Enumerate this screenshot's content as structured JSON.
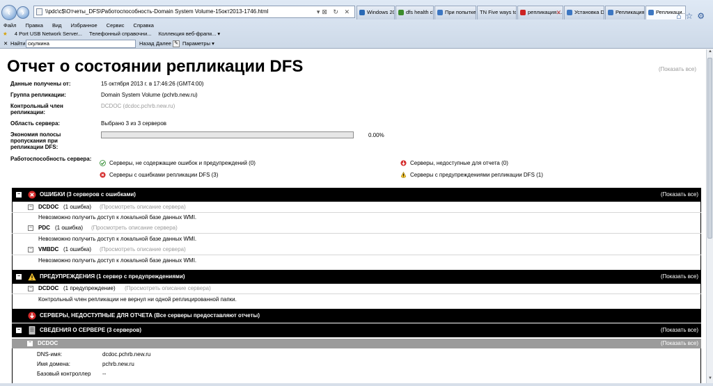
{
  "browser": {
    "address": "\\\\pdc\\c$\\Отчеты_DFS\\Работоспособность-Domain System Volume-15окт2013-1746.html",
    "tabs": [
      {
        "label": "Windows 201...",
        "color": "#2a6ab5"
      },
      {
        "label": "dfs health ch...",
        "color": "#3c8c2c"
      },
      {
        "label": "При попытке...",
        "color": "#3d77c2"
      },
      {
        "label": "TN Five ways to ...",
        "color": "#555555"
      },
      {
        "label": "репликация ...",
        "color": "#cc2222"
      },
      {
        "label": "Установка D...",
        "color": "#3d77c2"
      },
      {
        "label": "Репликация ...",
        "color": "#3d77c2"
      },
      {
        "label": "Репликаци...",
        "color": "#3d77c2"
      }
    ],
    "menu": [
      "Файл",
      "Правка",
      "Вид",
      "Избранное",
      "Сервис",
      "Справка"
    ],
    "favorites": [
      "4 Port USB Network Server...",
      "Телефонный справочни...",
      "Коллекция веб-фрагм... ▾"
    ],
    "find": {
      "close": "✕",
      "label": "Найти:",
      "value": "скулкина",
      "prev": "Назад",
      "next": "Далее",
      "options": "Параметры ▾"
    }
  },
  "report": {
    "title": "Отчет о состоянии репликации DFS",
    "show_all": "(Показать все)",
    "info": {
      "received_label": "Данные получены от:",
      "received_value": "15 октября 2013 г. в 17:46:26 (GMT4:00)",
      "group_label": "Группа репликации:",
      "group_value": "Domain System Volume (pchrb.new.ru)",
      "member_label": "Контрольный член репликации:",
      "member_value": "DCDOC (dcdoc.pchrb.new.ru)",
      "scope_label": "Область сервера:",
      "scope_value": "Выбрано 3 из 3 серверов",
      "bandwidth_label": "Экономия полосы пропускания при репликации DFS:",
      "bandwidth_value": "0.00%",
      "bandwidth_fraction": 0,
      "health_label": "Работоспособность сервера:"
    },
    "legend": {
      "ok": "Серверы, не содержащие ошибок и предупреждений (0)",
      "errors": "Серверы с ошибками репликации DFS (3)",
      "unavailable": "Серверы, недоступные для отчета (0)",
      "warnings": "Серверы с предупреждениями репликации DFS (1)"
    },
    "errors_section": {
      "title": "ОШИБКИ  (3 серверов с ошибками)",
      "show_all": "(Показать все)",
      "servers": [
        {
          "name": "DCDOC",
          "count": "(1 ошибка)",
          "link": "(Просмотреть описание сервера)",
          "message": "Невозможно получить доступ к локальной базе данных WMI."
        },
        {
          "name": "PDC",
          "count": "(1 ошибка)",
          "link": "(Просмотреть описание сервера)",
          "message": "Невозможно получить доступ к локальной базе данных WMI."
        },
        {
          "name": "VMBDC",
          "count": "(1 ошибка)",
          "link": "(Просмотреть описание сервера)",
          "message": "Невозможно получить доступ к локальной базе данных WMI."
        }
      ]
    },
    "warnings_section": {
      "title": "ПРЕДУПРЕЖДЕНИЯ  (1 сервер с предупреждениями)",
      "show_all": "(Показать все)",
      "servers": [
        {
          "name": "DCDOC",
          "count": "(1 предупреждение)",
          "link": "(Просмотреть описание сервера)",
          "message": "Контрольный член репликации не вернул ни одной реплицированной папки."
        }
      ]
    },
    "unavailable_section": {
      "title": "СЕРВЕРЫ, НЕДОСТУПНЫЕ ДЛЯ ОТЧЕТА  (Все серверы предоставляют отчеты)"
    },
    "server_info_section": {
      "title": "СВЕДЕНИЯ О СЕРВЕРЕ  (3 серверов)",
      "show_all": "(Показать все)",
      "server": {
        "name": "DCDOC",
        "show_all": "(Показать все)",
        "details": [
          {
            "label": "DNS-имя:",
            "value": "dcdoc.pchrb.new.ru"
          },
          {
            "label": "Имя домена:",
            "value": "pchrb.new.ru"
          },
          {
            "label": "Базовый контроллер",
            "value": "--"
          }
        ]
      }
    }
  }
}
